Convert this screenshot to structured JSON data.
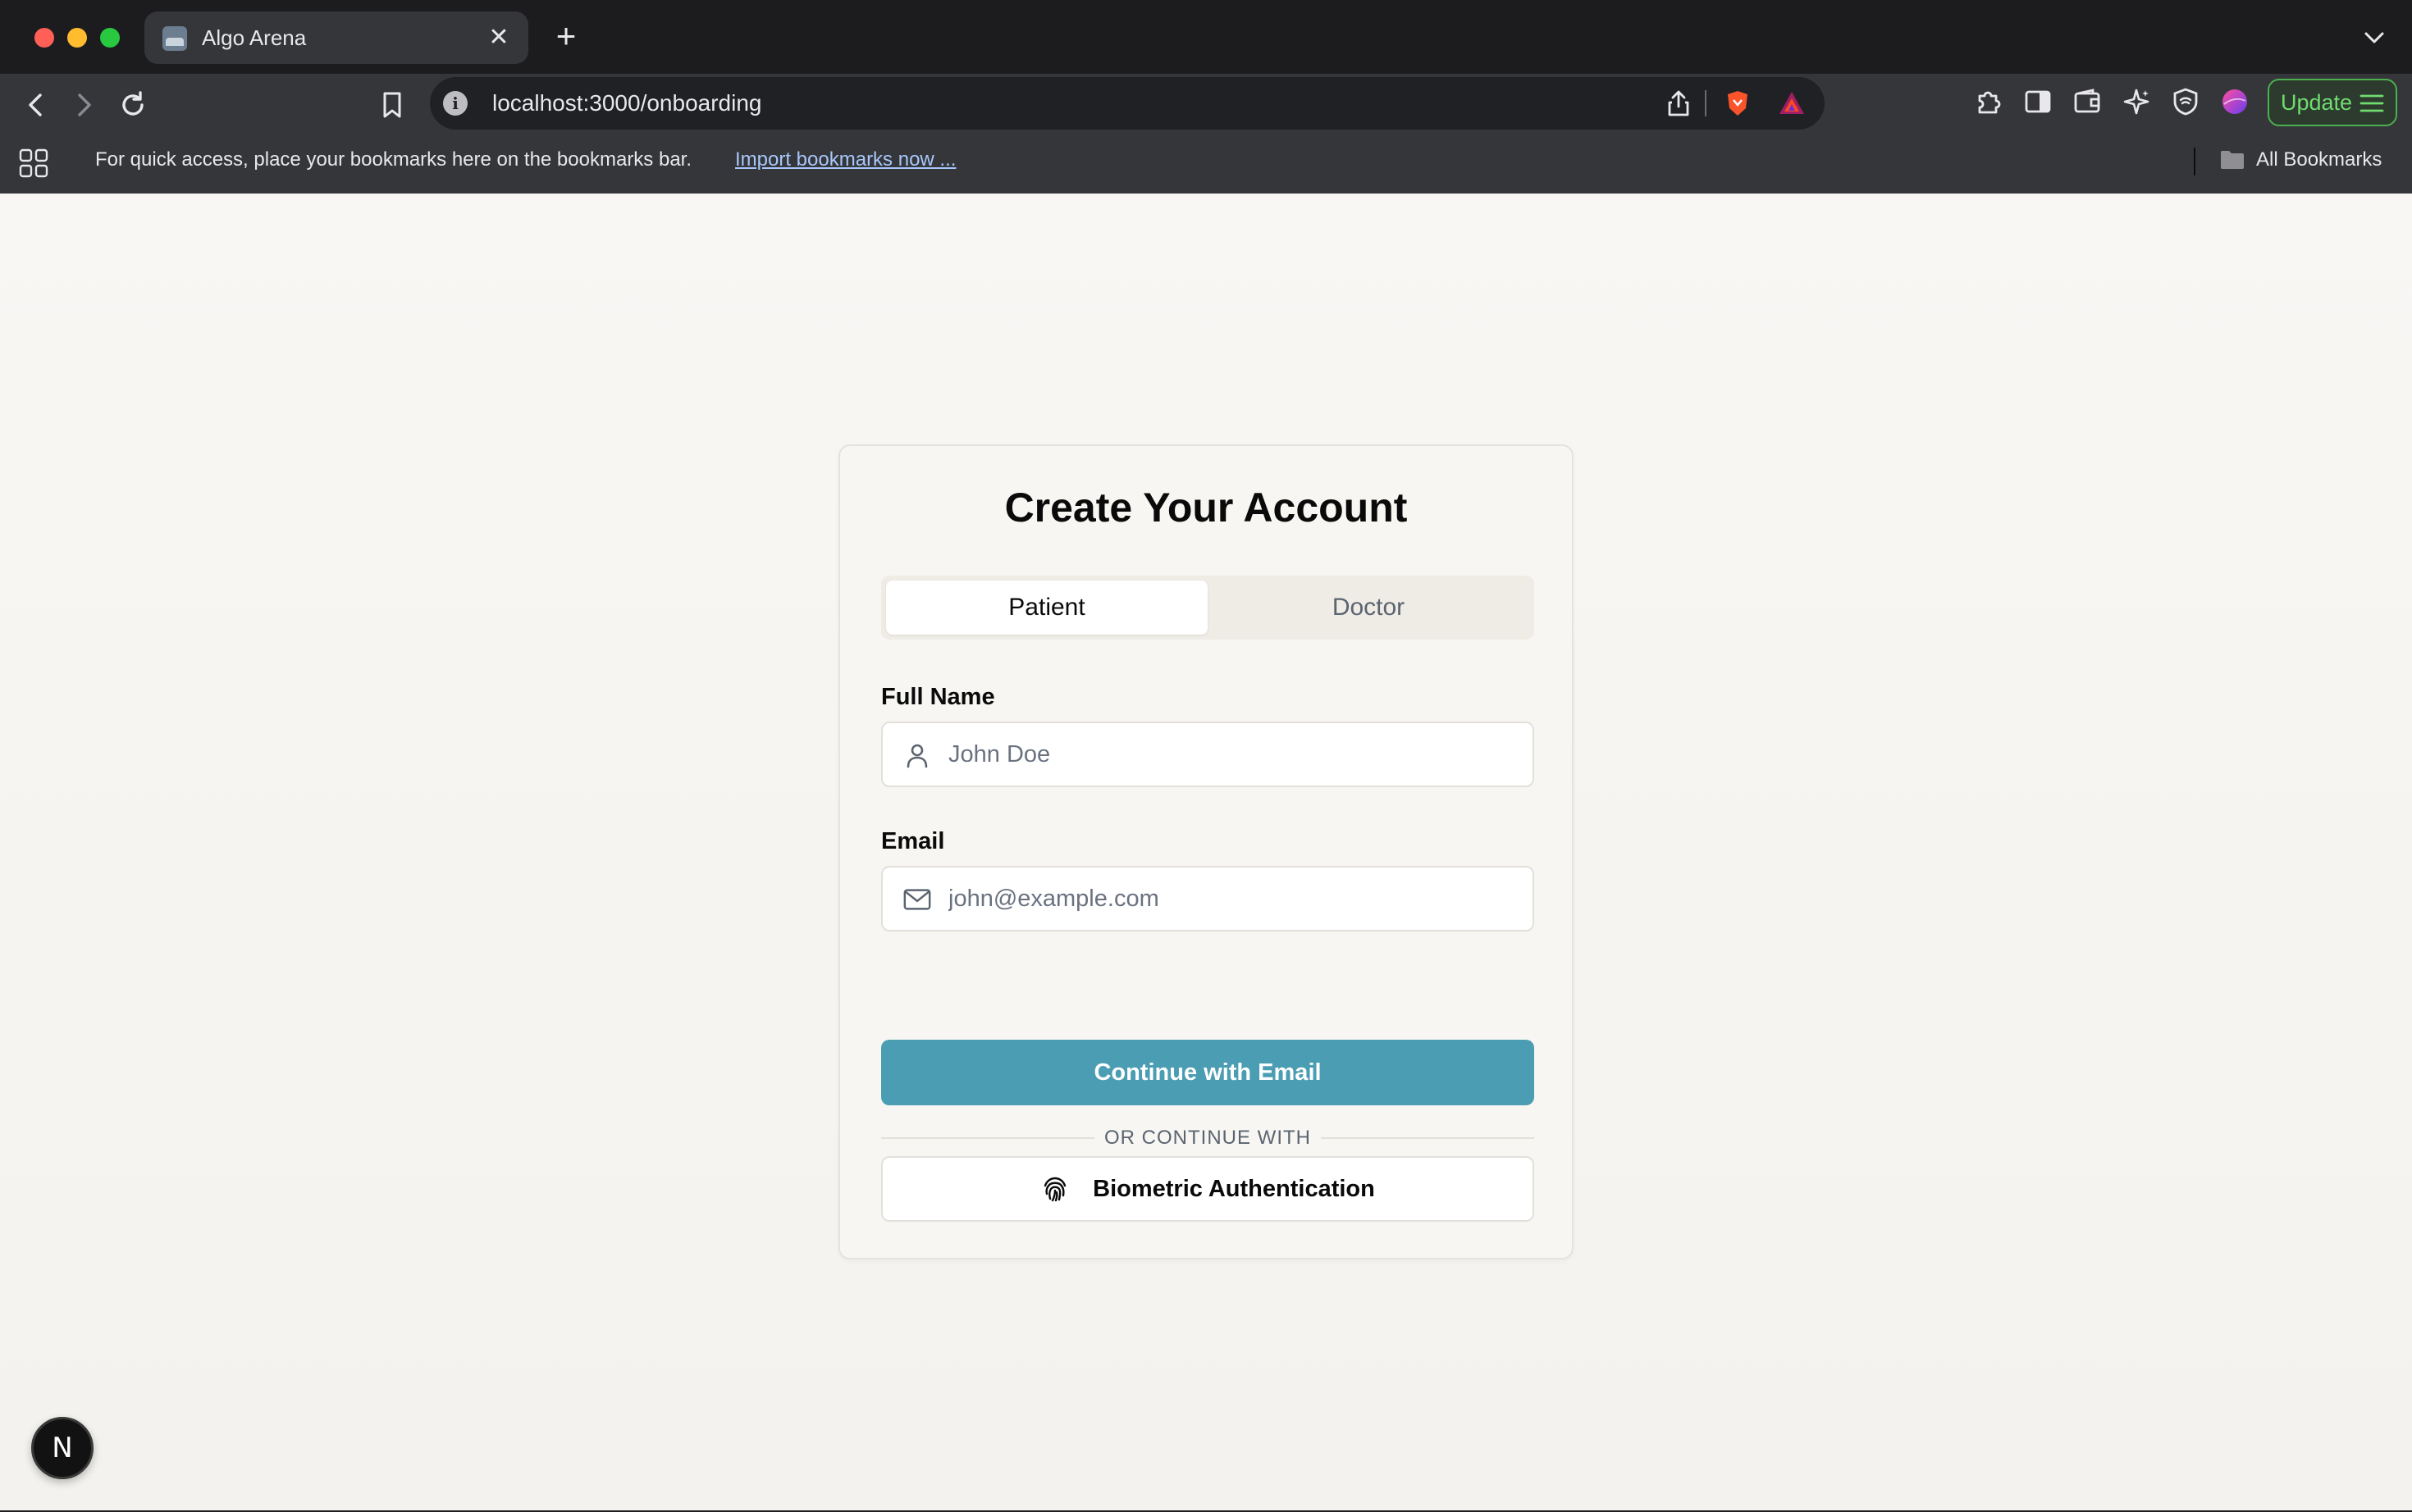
{
  "browser": {
    "tab_title": "Algo Arena",
    "tab_close": "✕",
    "new_tab": "+",
    "url": "localhost:3000/onboarding",
    "update_label": "Update",
    "bookmarks_prompt": "For quick access, place your bookmarks here on the bookmarks bar.",
    "import_bookmarks": "Import bookmarks now ...",
    "all_bookmarks": "All Bookmarks"
  },
  "page": {
    "title": "Create Your Account",
    "tabs": [
      {
        "label": "Patient",
        "active": true
      },
      {
        "label": "Doctor",
        "active": false
      }
    ],
    "full_name": {
      "label": "Full Name",
      "placeholder": "John Doe",
      "value": ""
    },
    "email": {
      "label": "Email",
      "placeholder": "john@example.com",
      "value": ""
    },
    "continue_button": "Continue with Email",
    "divider_text": "OR CONTINUE WITH",
    "biometric_button": "Biometric Authentication"
  },
  "dev_badge": {
    "letter": "N"
  },
  "colors": {
    "primary": "#4a9db2",
    "page_bg": "#f8f7f4",
    "update_green": "#6fdc6f"
  },
  "icons": {
    "back": "arrow-left-icon",
    "forward": "arrow-right-icon",
    "reload": "reload-icon",
    "bookmark": "bookmark-icon",
    "site_info": "info-icon",
    "share": "share-icon",
    "user": "user-icon",
    "mail": "mail-icon",
    "fingerprint": "fingerprint-icon"
  }
}
